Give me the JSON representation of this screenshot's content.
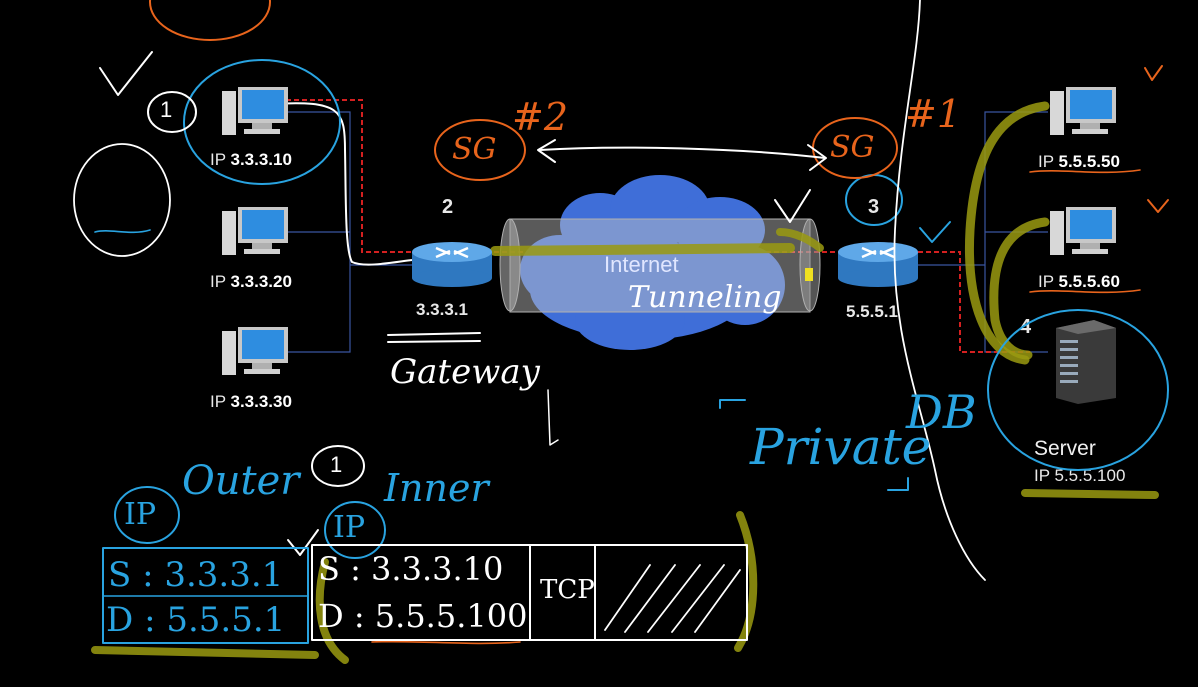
{
  "hosts_left": [
    {
      "prefix": "IP",
      "ip": "3.3.3.10"
    },
    {
      "prefix": "IP",
      "ip": "3.3.3.20"
    },
    {
      "prefix": "IP",
      "ip": "3.3.3.30"
    }
  ],
  "hosts_right": [
    {
      "prefix": "IP",
      "ip": "5.5.5.50"
    },
    {
      "prefix": "IP",
      "ip": "5.5.5.60"
    }
  ],
  "router_left": {
    "number": "2",
    "ip": "3.3.3.1"
  },
  "router_right": {
    "number": "3",
    "ip": "5.5.5.1"
  },
  "server": {
    "number": "4",
    "name": "Server",
    "prefix": "IP",
    "ip": "5.5.5.100"
  },
  "cloud_label": "Internet",
  "annotations": {
    "step_one": "1",
    "sg_left": "SG",
    "sg_left_num": "#2",
    "sg_right": "SG",
    "sg_right_num": "#1",
    "tunneling": "Tunneling",
    "gateway": "Gateway",
    "private": "Private",
    "db": "DB",
    "outer": "Outer",
    "inner": "Inner",
    "outer_ip": "IP",
    "inner_ip": "IP",
    "outer_src": "S : 3.3.3.1",
    "outer_dst": "D : 5.5.5.1",
    "inner_src": "S : 3.3.3.10",
    "inner_dst": "D : 5.5.5.100",
    "tcp": "TCP"
  },
  "colors": {
    "handwriting_blue": "#29a3e0",
    "handwriting_orange": "#e8641c",
    "highlighter": "#9a9a10",
    "cable": "#3a55a0",
    "route": "#d42020"
  }
}
